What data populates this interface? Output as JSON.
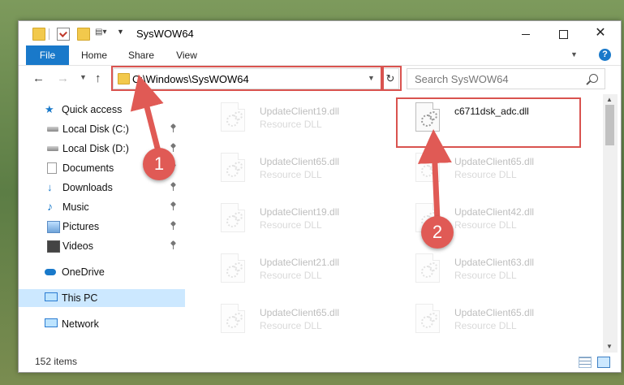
{
  "window": {
    "title": "SysWOW64",
    "controls": {
      "minimize": "",
      "maximize": "",
      "close": "✕"
    }
  },
  "ribbon": {
    "tabs": [
      "File",
      "Home",
      "Share",
      "View"
    ],
    "help": "?"
  },
  "address": {
    "path": "C:\\Windows\\SysWOW64",
    "search_placeholder": "Search SysWOW64"
  },
  "sidebar": {
    "quick_access": "Quick access",
    "items": [
      {
        "label": "Local Disk (C:)",
        "icon": "drive-icon",
        "pinned": true
      },
      {
        "label": "Local Disk (D:)",
        "icon": "drive-icon",
        "pinned": true
      },
      {
        "label": "Documents",
        "icon": "documents-icon",
        "pinned": true
      },
      {
        "label": "Downloads",
        "icon": "downloads-icon",
        "pinned": true
      },
      {
        "label": "Music",
        "icon": "music-icon",
        "pinned": true
      },
      {
        "label": "Pictures",
        "icon": "pictures-icon",
        "pinned": true
      },
      {
        "label": "Videos",
        "icon": "videos-icon",
        "pinned": true
      }
    ],
    "onedrive": "OneDrive",
    "this_pc": "This PC",
    "network": "Network"
  },
  "files": {
    "left_column": [
      {
        "name": "UpdateClient19.dll",
        "type": "Resource DLL"
      },
      {
        "name": "UpdateClient65.dll",
        "type": "Resource DLL"
      },
      {
        "name": "UpdateClient19.dll",
        "type": "Resource DLL"
      },
      {
        "name": "UpdateClient21.dll",
        "type": "Resource DLL"
      },
      {
        "name": "UpdateClient65.dll",
        "type": "Resource DLL"
      }
    ],
    "right_column": [
      {
        "name": "c6711dsk_adc.dll",
        "type": ""
      },
      {
        "name": "UpdateClient65.dll",
        "type": "Resource DLL"
      },
      {
        "name": "UpdateClient42.dll",
        "type": "Resource DLL"
      },
      {
        "name": "UpdateClient63.dll",
        "type": "Resource DLL"
      },
      {
        "name": "UpdateClient65.dll",
        "type": "Resource DLL"
      }
    ]
  },
  "status": {
    "item_count": "152 items"
  },
  "annotations": {
    "step1": "1",
    "step2": "2",
    "color": "#e05a55"
  },
  "colors": {
    "accent": "#1979ca",
    "selection": "#cce8ff",
    "highlight": "#d9534f"
  }
}
